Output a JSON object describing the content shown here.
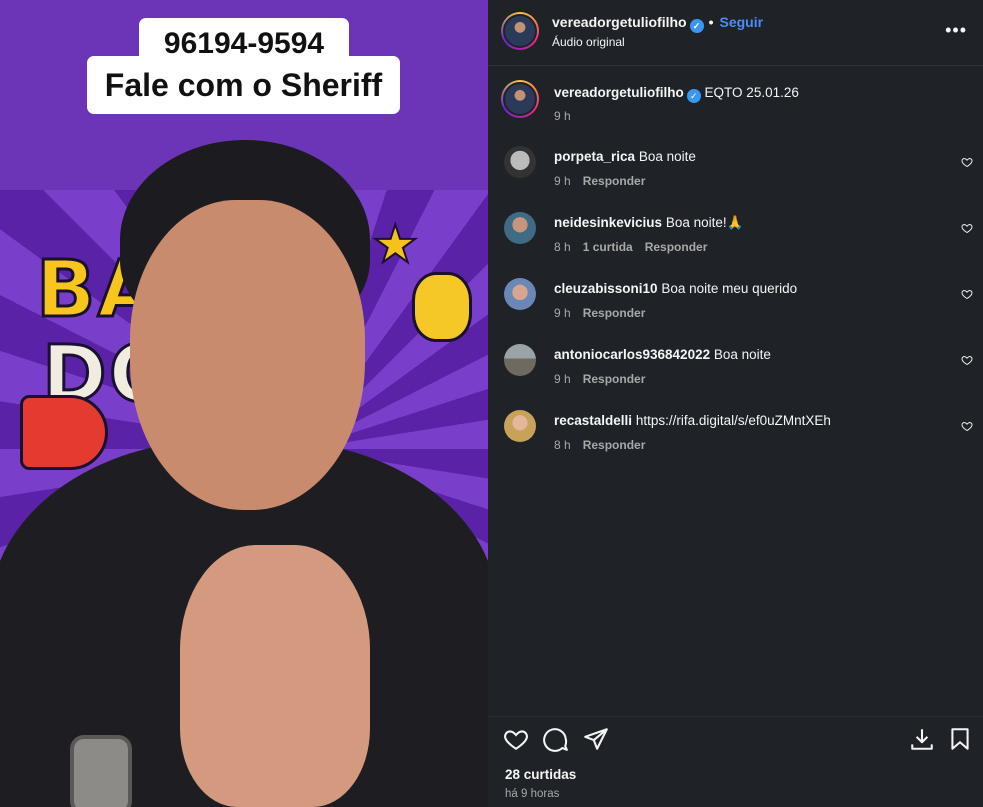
{
  "media": {
    "phone_caption": "96194-9594",
    "sheriff_caption": "Fale com o Sheriff",
    "art_text_1": "BA",
    "art_text_2": "DO",
    "bg_color": "#6c34b6"
  },
  "post": {
    "username": "vereadorgetuliofilho",
    "follow_label": "Seguir",
    "audio_label": "Áudio original",
    "more_icon": "more-horizontal-icon"
  },
  "caption": {
    "username": "vereadorgetuliofilho",
    "text": "EQTO 25.01.26",
    "time": "9 h"
  },
  "comments": [
    {
      "username": "porpeta_rica",
      "text": "Boa noite",
      "time": "9 h",
      "likes": "",
      "reply": "Responder"
    },
    {
      "username": "neidesinkevicius",
      "text": "Boa noite!🙏",
      "time": "8 h",
      "likes": "1 curtida",
      "reply": "Responder"
    },
    {
      "username": "cleuzabissoni10",
      "text": "Boa noite meu querido",
      "time": "9 h",
      "likes": "",
      "reply": "Responder"
    },
    {
      "username": "antoniocarlos936842022",
      "text": "Boa noite",
      "time": "9 h",
      "likes": "",
      "reply": "Responder"
    },
    {
      "username": "recastaldelli",
      "text": "https://rifa.digital/s/ef0uZMntXEh",
      "time": "8 h",
      "likes": "",
      "reply": "Responder"
    }
  ],
  "footer": {
    "likes_count": "28 curtidas",
    "time_ago": "há 9 horas"
  },
  "colors": {
    "panel_bg": "#1f2227",
    "link_blue": "#4a8df8",
    "muted_text": "#a8a8a8"
  }
}
